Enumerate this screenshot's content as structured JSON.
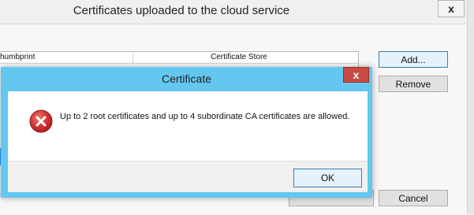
{
  "parent_window": {
    "title": "Certificates uploaded to the cloud service",
    "close_glyph": "x",
    "table": {
      "columns": [
        "humbprint",
        "Certificate Store"
      ]
    },
    "buttons": {
      "add": "Add...",
      "remove": "Remove",
      "cancel": "Cancel"
    }
  },
  "dialog": {
    "title": "Certificate",
    "close_glyph": "x",
    "icon": "error-icon",
    "message": "Up to 2 root certificates and up to 4 subordinate CA certificates are allowed.",
    "ok_label": "OK"
  },
  "colors": {
    "dialog_frame": "#63c7f0",
    "close_red": "#c74b43",
    "error_red": "#d32f2f",
    "selection_blue": "#3399ff"
  }
}
